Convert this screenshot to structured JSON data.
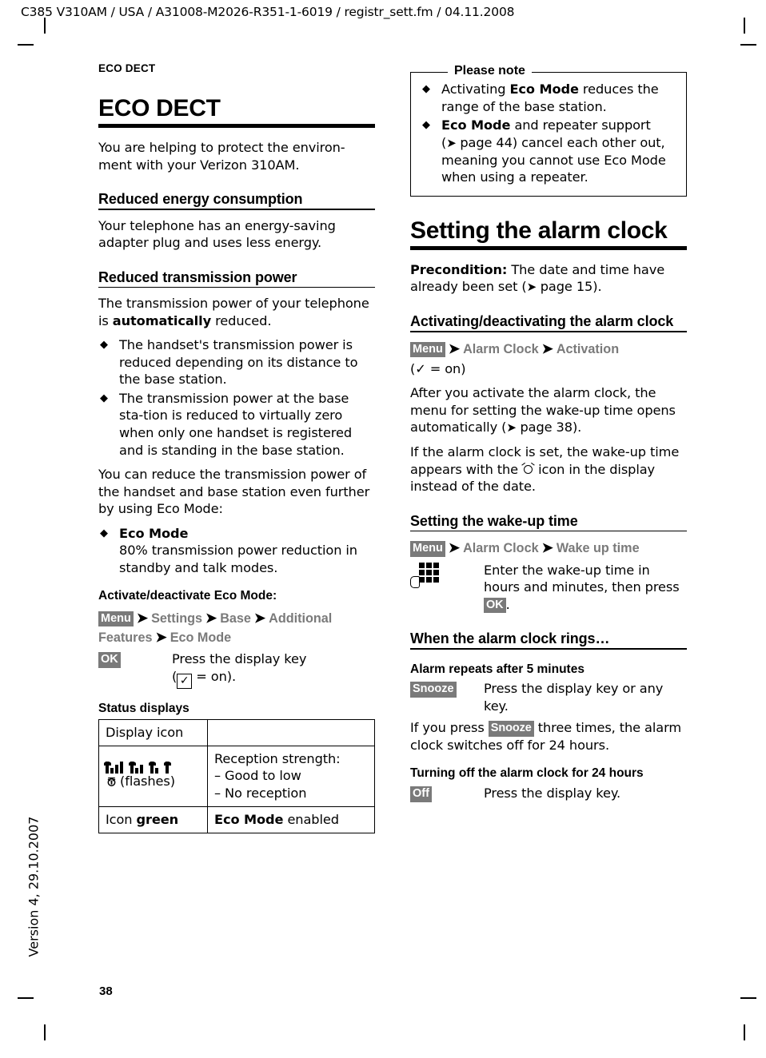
{
  "header": {
    "running_head": "C385 V310AM / USA / A31008-M2026-R351-1-6019 / registr_sett.fm / 04.11.2008"
  },
  "margin": {
    "version_text": "Version 4, 29.10.2007",
    "page_number": "38"
  },
  "left_column": {
    "folio_title": "ECO DECT",
    "chapter_title": "ECO DECT",
    "intro": "You are helping to protect the environ-ment with your Verizon 310AM.",
    "section_energy": {
      "heading": "Reduced energy consumption",
      "body": "Your telephone has an energy-saving adapter plug and uses less energy."
    },
    "section_power": {
      "heading": "Reduced transmission power",
      "intro_a": "The transmission power of your telephone is ",
      "intro_b": "automatically",
      "intro_c": " reduced.",
      "bullets": [
        "The handset's transmission power is reduced depending on its distance to the base station.",
        "The transmission power at the base sta-tion is reduced to virtually zero when only one handset is registered and is standing in the base station."
      ],
      "reduce_more": "You can reduce the transmission power of the handset and base station even further by using Eco Mode:",
      "eco_bullet_title": "Eco Mode",
      "eco_bullet_body": "80% transmission power reduction in standby and talk modes."
    },
    "activate_eco": {
      "heading": "Activate/deactivate Eco Mode:",
      "menu_key": "Menu",
      "path": [
        "Settings",
        "Base",
        "Additional Features",
        "Eco Mode"
      ],
      "ok_key": "OK",
      "ok_desc_line1": "Press the display key",
      "ok_desc_line2_open": "(",
      "ok_desc_check": "✓",
      "ok_desc_line2_close": " = on)."
    },
    "status_displays": {
      "heading": "Status displays",
      "col1_header": "Display icon",
      "col2_header": "",
      "row2": {
        "icon_note": "(flashes)",
        "desc_title": "Reception strength:",
        "desc_line1": "– Good to low",
        "desc_line2": "– No reception"
      },
      "row3": {
        "icon_label_a": "Icon ",
        "icon_label_b": "green",
        "desc_a": "Eco Mode",
        "desc_b": " enabled"
      }
    }
  },
  "right_column": {
    "please_note": {
      "title": "Please note",
      "bullet1_a": "Activating ",
      "bullet1_b": "Eco Mode",
      "bullet1_c": " reduces the range of the base station.",
      "bullet2_a": "Eco Mode",
      "bullet2_b": " and repeater support (",
      "bullet2_ref": "page 44",
      "bullet2_c": ") cancel each other out, meaning you cannot use Eco Mode when using a repeater."
    },
    "alarm_clock": {
      "chapter_title": "Setting the alarm clock",
      "precondition_label": "Precondition:",
      "precondition_text": " The date and time have already been set (",
      "precondition_ref": "page 15",
      "precondition_end": ")."
    },
    "activating": {
      "heading": "Activating/deactivating the alarm clock",
      "menu_key": "Menu",
      "path": [
        "Alarm Clock",
        "Activation"
      ],
      "check_note": "(✓ = on)",
      "body1_a": "After you activate the alarm clock, the menu for setting the wake-up time opens automatically (",
      "body1_ref": "page 38",
      "body1_b": ").",
      "body2_a": "If the alarm clock is set, the wake-up time appears with the ",
      "body2_b": " icon in the display instead of the date."
    },
    "wakeup": {
      "heading": "Setting the wake-up time",
      "menu_key": "Menu",
      "path": [
        "Alarm Clock",
        "Wake up time"
      ],
      "desc_a": "Enter the wake-up time in hours and minutes, then press ",
      "ok_key": "OK",
      "desc_b": "."
    },
    "rings": {
      "heading": "When the alarm clock rings…",
      "repeat_heading": "Alarm repeats after 5 minutes",
      "snooze_key": "Snooze",
      "snooze_desc": "Press the display key or any key.",
      "three_times_a": "If you press ",
      "three_times_key": "Snooze",
      "three_times_b": " three times, the alarm clock switches off for 24 hours.",
      "turnoff_heading": "Turning off the alarm clock for 24 hours",
      "off_key": "Off",
      "off_desc": "Press the display key."
    }
  },
  "colors": {
    "key_badge_bg": "#7a7a7a",
    "key_badge_fg": "#ffffff",
    "menu_path_text": "#7a7a7a",
    "rule": "#000000"
  },
  "icons": {
    "arrow": "➜",
    "diamond_bullet": "◆"
  }
}
